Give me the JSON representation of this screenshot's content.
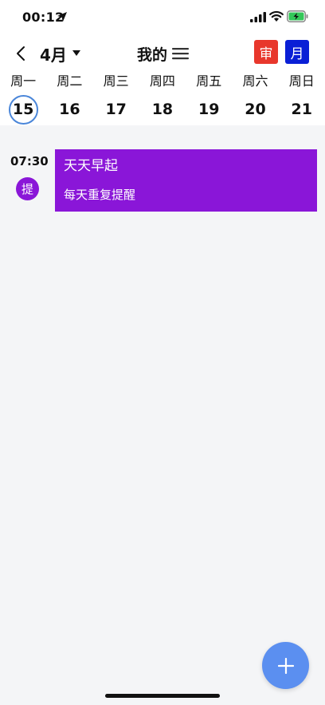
{
  "status_bar": {
    "time": "00:12",
    "icons": [
      "location-arrow-icon",
      "signal-icon",
      "wifi-icon",
      "battery-charging-icon"
    ]
  },
  "nav": {
    "month": "4月",
    "title": "我的",
    "view_buttons": [
      "审",
      "月"
    ],
    "icons": [
      "chevron-left-icon",
      "caret-down-icon",
      "menu-icon"
    ]
  },
  "week": {
    "days": [
      "周一",
      "周二",
      "周三",
      "周四",
      "周五",
      "周六",
      "周日"
    ],
    "dates": [
      "15",
      "16",
      "17",
      "18",
      "19",
      "20",
      "21"
    ],
    "selected_index": 0
  },
  "events": [
    {
      "time": "07:30",
      "badge": "提",
      "title": "天天早起",
      "subtitle": "每天重复提醒"
    }
  ],
  "colors": {
    "event": "#8a16d8",
    "fab": "#5b8ff0",
    "selected_ring": "#4a86d9",
    "shen_button": "#e8372c",
    "yue_button": "#0a1fd6"
  }
}
